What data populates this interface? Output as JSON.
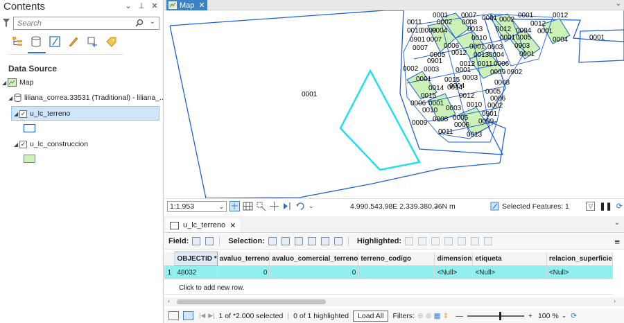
{
  "contents": {
    "title": "Contents",
    "controls": [
      "⌄",
      "⊥",
      "✕"
    ],
    "search_placeholder": "Search",
    "data_source_label": "Data Source",
    "tree": {
      "map": "Map",
      "database": "liliana_correa.33531 (Traditional) - liliana_...",
      "layer1": "u_lc_terreno",
      "layer2": "u_lc_construccion"
    },
    "colors": {
      "terreno_symbol": "#1f5fd6",
      "construccion_symbol": "#ccf2b8"
    }
  },
  "map_tab": {
    "label": "Map"
  },
  "map": {
    "labels": {
      "big_parcel": "0001",
      "right_parcel": "0001",
      "parcel_ids": [
        "0001",
        "0002",
        "0003",
        "0004",
        "0005",
        "0006",
        "0007",
        "0008",
        "0009",
        "0010",
        "0011",
        "0012",
        "0013",
        "0014",
        "0015",
        "0901",
        "0902",
        "0903",
        "0004",
        "00050001",
        "09020003",
        "0012",
        "0001"
      ]
    },
    "colors": {
      "parcel_outline": "#1f5fd6",
      "selected_outline": "#21e0ea",
      "construccion_fill": "#ccf2b8"
    }
  },
  "map_status": {
    "scale": "1:1.953",
    "coordinates": "4.990.543,98E 2.339.380,36N m",
    "selected_features": "Selected Features: 1"
  },
  "table": {
    "tab_label": "u_lc_terreno",
    "toolbar": {
      "field": "Field:",
      "selection": "Selection:",
      "highlighted": "Highlighted:"
    },
    "columns": [
      "OBJECTID *",
      "avaluo_terreno",
      "avaluo_comercial_terreno",
      "terreno_codigo",
      "dimension",
      "etiqueta",
      "relacion_superficie"
    ],
    "rows": [
      {
        "num": "1",
        "OBJECTID": "48032",
        "avaluo_terreno": "0",
        "avaluo_comercial_terreno": "0",
        "terreno_codigo": "",
        "dimension": "<Null>",
        "etiqueta": "<Null>",
        "relacion_superficie": "<Null>"
      }
    ],
    "add_row": "Click to add new row.",
    "status": {
      "selected": "1 of *2.000 selected",
      "highlighted": "0 of 1 highlighted",
      "load_all": "Load All",
      "filters": "Filters:",
      "zoom": "100 %"
    }
  }
}
